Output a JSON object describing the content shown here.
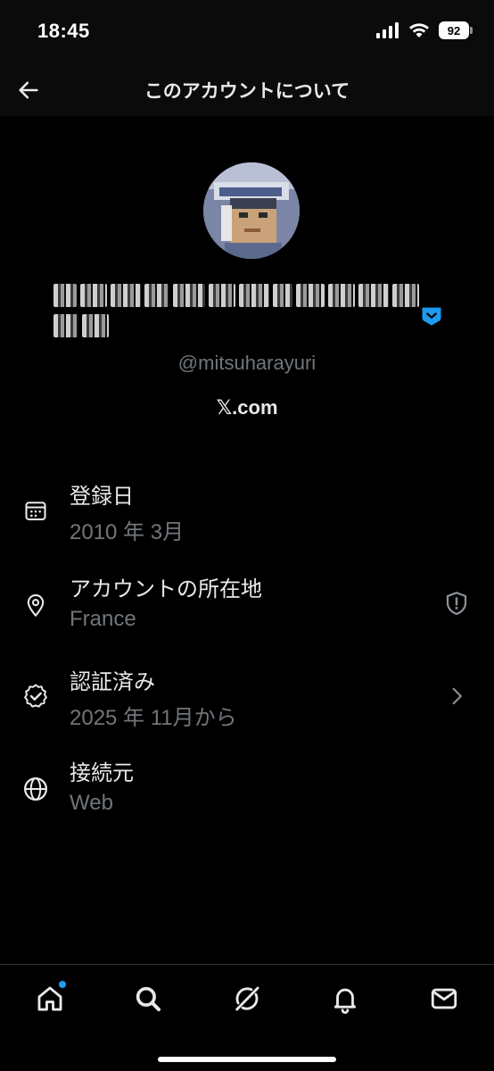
{
  "status_bar": {
    "time": "18:45",
    "battery": "92"
  },
  "header": {
    "title": "このアカウントについて"
  },
  "profile": {
    "handle": "@mitsuharayuri",
    "via": "𝕏.com"
  },
  "info": [
    {
      "label": "登録日",
      "value": "2010 年 3月",
      "icon": "calendar-icon"
    },
    {
      "label": "アカウントの所在地",
      "value": "France",
      "icon": "location-pin-icon",
      "right_icon": "shield-alert-icon"
    },
    {
      "label": "認証済み",
      "value": "2025 年 11月から",
      "icon": "verified-badge-icon",
      "right_icon": "chevron-right-icon"
    },
    {
      "label": "接続元",
      "value": "Web",
      "icon": "globe-icon"
    }
  ],
  "tab_bar": {
    "tabs": [
      "home-icon",
      "search-icon",
      "grok-icon",
      "notifications-icon",
      "messages-icon"
    ]
  },
  "colors": {
    "background": "#000000",
    "text": "#e7e9ea",
    "muted": "#71767b",
    "accent": "#1d9bf0",
    "divider": "#2f3336"
  }
}
